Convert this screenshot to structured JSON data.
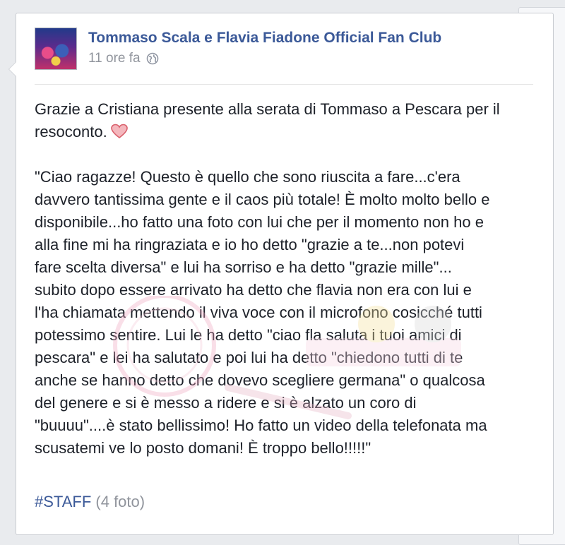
{
  "post": {
    "page_name": "Tommaso Scala e Flavia Fiadone Official Fan Club",
    "timestamp": "11 ore fa",
    "privacy_icon": "globe-icon",
    "intro_lines": [
      "Grazie a Cristiana presente alla serata di Tommaso a Pescara per il",
      "resoconto."
    ],
    "reaction_icon": "heart-icon",
    "body_lines": [
      "\"Ciao ragazze! Questo è quello che sono riuscita a fare...c'era",
      "davvero tantissima gente e il caos più totale! È molto molto bello e",
      "disponibile...ho fatto una foto con lui che per il momento non ho e",
      "alla fine mi ha ringraziata e io ho detto \"grazie a te...non potevi",
      "fare scelta diversa\" e lui ha sorriso e ha detto \"grazie mille\"...",
      "subito dopo essere arrivato ha detto che flavia non era con lui e",
      "l'ha chiamata mettendo il viva voce con il microfono cosicché tutti",
      "potessimo sentire. Lui le ha detto \"ciao fla saluta i tuoi amici di",
      "pescara\" e lei ha salutato e poi lui ha detto \"chiedono tutti di te",
      "anche se hanno detto che dovevo scegliere germana\" o qualcosa",
      "del genere e si è messo a ridere e si è alzato un coro di",
      "\"buuuu\"....è stato bellissimo! Ho fatto un video della telefonata ma",
      "scusatemi ve lo posto domani! È troppo bello!!!!!\""
    ],
    "hashtag": "#STAFF",
    "photo_count": "(4 foto)"
  },
  "colors": {
    "link": "#3b5998",
    "meta": "#90949c",
    "text": "#1d2129",
    "heart": "#e0707a"
  }
}
